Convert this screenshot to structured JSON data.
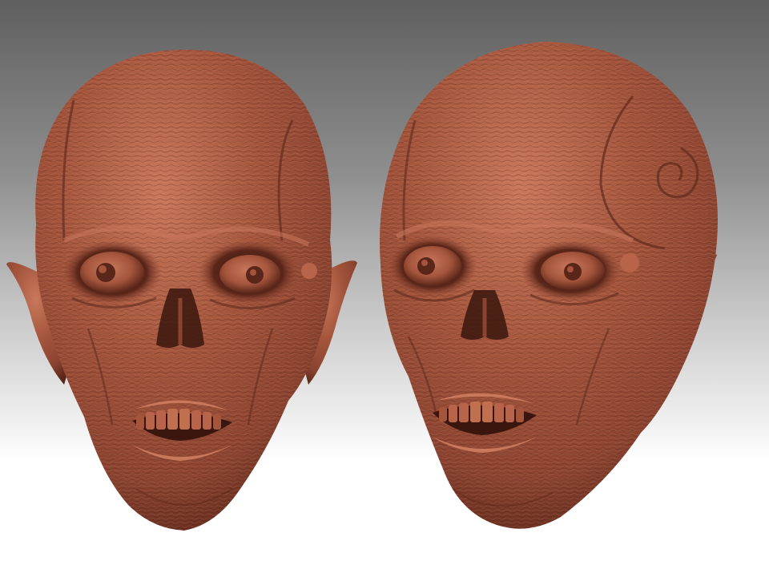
{
  "scene": {
    "background_gradient": [
      "#5f5f5f",
      "#8e8e8e",
      "#c9c9c9",
      "#ffffff"
    ],
    "clay_colors": {
      "highlight": "#c9785c",
      "base": "#a4553c",
      "mid": "#8a4330",
      "shadow": "#5a2619",
      "deep": "#3a160e"
    }
  },
  "objects": [
    {
      "name": "head-sculpt-front",
      "view": "front"
    },
    {
      "name": "head-sculpt-three-quarter",
      "view": "three-quarter"
    }
  ]
}
